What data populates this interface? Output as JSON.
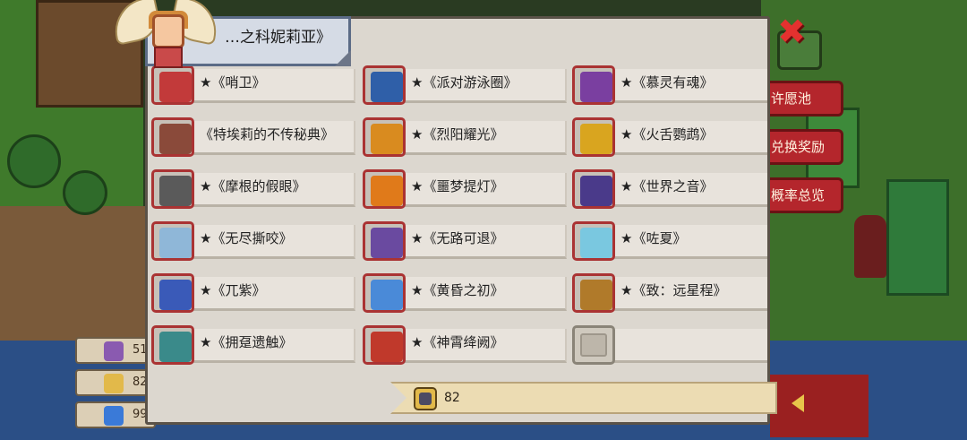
{
  "title": "…之科妮莉亚》",
  "close_symbol": "✖",
  "side_menu": [
    "许愿池",
    "兑换奖励",
    "概率总览"
  ],
  "currencies": [
    {
      "icon": "purple-crystal-icon",
      "value": "51"
    },
    {
      "icon": "helmet-token-icon",
      "value": "82"
    },
    {
      "icon": "blue-gem-icon",
      "value": "99"
    }
  ],
  "items": [
    {
      "label": "★《哨卫》",
      "icon": "sentinel-icon",
      "color": "#c23a3a"
    },
    {
      "label": "★《派对游泳圈》",
      "icon": "swim-ring-icon",
      "color": "#2f5fa8"
    },
    {
      "label": "★《慕灵有魂》",
      "icon": "spirit-icon",
      "color": "#7a3fa0"
    },
    {
      "label": "《特埃莉的不传秘典》",
      "icon": "tome-icon",
      "color": "#8a4a3a"
    },
    {
      "label": "★《烈阳耀光》",
      "icon": "sun-staff-icon",
      "color": "#d98b1f"
    },
    {
      "label": "★《火舌鹦鹉》",
      "icon": "fire-parrot-gun-icon",
      "color": "#d9a51f"
    },
    {
      "label": "★《摩根的假眼》",
      "icon": "fake-eye-icon",
      "color": "#5a5a5a"
    },
    {
      "label": "★《噩梦提灯》",
      "icon": "lantern-icon",
      "color": "#e07a1a"
    },
    {
      "label": "★《世界之音》",
      "icon": "piano-icon",
      "color": "#4a3a8a"
    },
    {
      "label": "★《无尽撕咬》",
      "icon": "endless-bite-icon",
      "color": "#8fb7d8"
    },
    {
      "label": "★《无路可退》",
      "icon": "boot-icon",
      "color": "#6a4aa0"
    },
    {
      "label": "★《咗夏》",
      "icon": "water-gun-icon",
      "color": "#7ac8e0"
    },
    {
      "label": "★《兀紫》",
      "icon": "purple-armor-icon",
      "color": "#3a5ab8"
    },
    {
      "label": "★《黄昏之初》",
      "icon": "dusk-ring-icon",
      "color": "#4a8ad8"
    },
    {
      "label": "★《致：远星程》",
      "icon": "gauntlet-icon",
      "color": "#b07a2a"
    },
    {
      "label": "★《拥趸遗触》",
      "icon": "tentacle-icon",
      "color": "#3a8a8a"
    },
    {
      "label": "★《神霄绛阙》",
      "icon": "amulet-icon",
      "color": "#c0392b"
    },
    {
      "label": "",
      "icon": "empty-slot-icon",
      "color": "#bdb6aa"
    }
  ],
  "footer": {
    "icon": "helmet-token-icon",
    "value": "82"
  }
}
